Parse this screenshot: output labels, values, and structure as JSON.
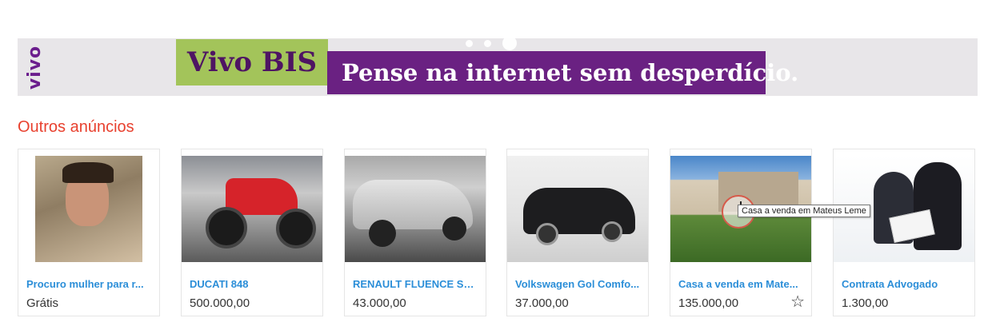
{
  "banner": {
    "brand": "vivo",
    "product": "Vivo BIS",
    "slogan": "Pense na internet sem desperdício.",
    "slides_total": 3,
    "active_slide": 3
  },
  "section": {
    "title": "Outros anúncios"
  },
  "cards": [
    {
      "title": "Procuro mulher para r...",
      "price": "Grátis",
      "image": "man-portrait"
    },
    {
      "title": "DUCATI 848",
      "price": "500.000,00",
      "image": "motorcycle"
    },
    {
      "title": "RENAULT FLUENCE Sed...",
      "price": "43.000,00",
      "image": "silver-sedan"
    },
    {
      "title": "Volkswagen Gol Comfo...",
      "price": "37.000,00",
      "image": "black-hatchback"
    },
    {
      "title": "Casa a venda em Mate...",
      "price": "135.000,00",
      "image": "house-yard",
      "favorite_icon": "star-outline-icon"
    },
    {
      "title": "Contrata Advogado",
      "price": "1.300,00",
      "image": "business-people"
    }
  ],
  "tooltip": {
    "text": "Casa a venda em Mateus Leme"
  },
  "colors": {
    "accent_red": "#e8412f",
    "link_blue": "#2b8ed8",
    "vivo_purple": "#6a2182",
    "bis_green": "#a3c45a"
  }
}
